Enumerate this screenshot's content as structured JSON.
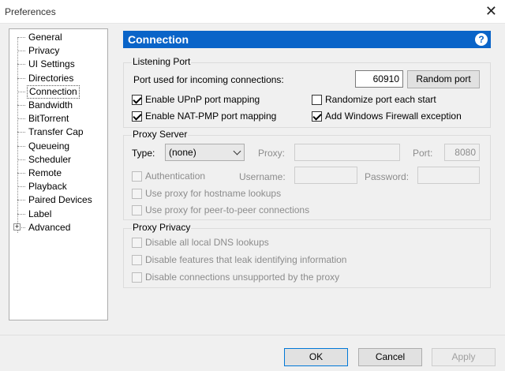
{
  "window": {
    "title": "Preferences",
    "close_glyph": "✕"
  },
  "sidebar": {
    "items": [
      {
        "label": "General"
      },
      {
        "label": "Privacy"
      },
      {
        "label": "UI Settings"
      },
      {
        "label": "Directories"
      },
      {
        "label": "Connection",
        "selected": true
      },
      {
        "label": "Bandwidth"
      },
      {
        "label": "BitTorrent"
      },
      {
        "label": "Transfer Cap"
      },
      {
        "label": "Queueing"
      },
      {
        "label": "Scheduler"
      },
      {
        "label": "Remote"
      },
      {
        "label": "Playback"
      },
      {
        "label": "Paired Devices"
      },
      {
        "label": "Label"
      },
      {
        "label": "Advanced",
        "expandable": true
      }
    ],
    "expander_glyph": "+"
  },
  "header": {
    "title": "Connection",
    "help_glyph": "?",
    "color": "#0a64c8"
  },
  "listening_port": {
    "title": "Listening Port",
    "port_label": "Port used for incoming connections:",
    "port_value": "60910",
    "random_button": "Random port",
    "upnp": {
      "label": "Enable UPnP port mapping",
      "checked": true
    },
    "natpmp": {
      "label": "Enable NAT-PMP port mapping",
      "checked": true
    },
    "randomize": {
      "label": "Randomize port each start",
      "checked": false
    },
    "firewall": {
      "label": "Add Windows Firewall exception",
      "checked": true
    }
  },
  "proxy_server": {
    "title": "Proxy Server",
    "type_label": "Type:",
    "type_value": "(none)",
    "proxy_label": "Proxy:",
    "proxy_value": "",
    "port_label": "Port:",
    "port_value": "8080",
    "auth_label": "Authentication",
    "username_label": "Username:",
    "password_label": "Password:",
    "hostname_lookups": "Use proxy for hostname lookups",
    "p2p_connections": "Use proxy for peer-to-peer connections"
  },
  "proxy_privacy": {
    "title": "Proxy Privacy",
    "dns": "Disable all local DNS lookups",
    "leak": "Disable features that leak identifying information",
    "unsupported": "Disable connections unsupported by the proxy"
  },
  "footer": {
    "ok": "OK",
    "cancel": "Cancel",
    "apply": "Apply"
  }
}
